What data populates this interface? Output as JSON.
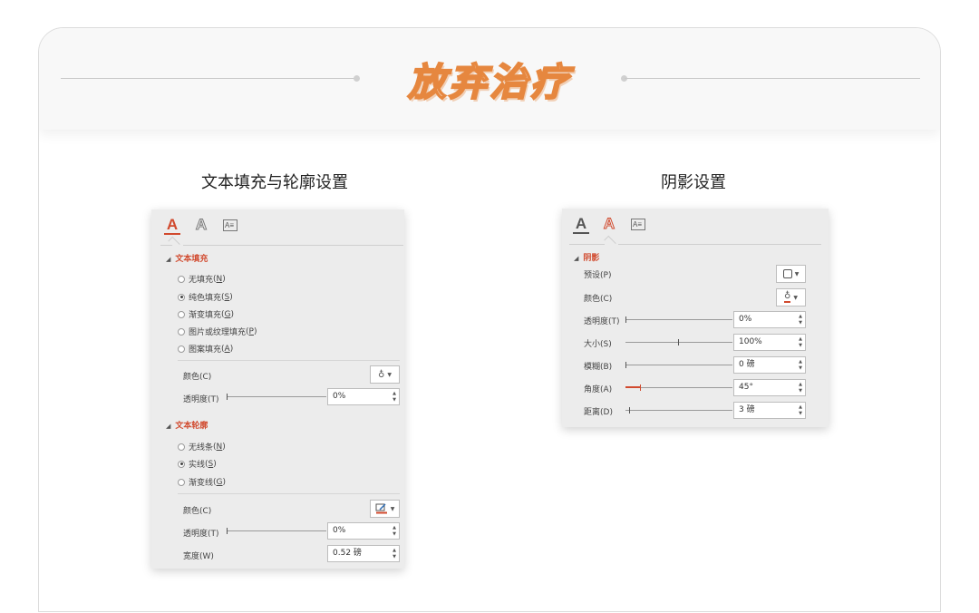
{
  "header": {
    "title": "放弃治疗"
  },
  "left": {
    "section_title": "文本填充与轮廓设置",
    "fill_group": "文本填充",
    "fill_options": [
      {
        "text": "无填充",
        "key": "N",
        "checked": false
      },
      {
        "text": "纯色填充",
        "key": "S",
        "checked": true
      },
      {
        "text": "渐变填充",
        "key": "G",
        "checked": false
      },
      {
        "text": "图片或纹理填充",
        "key": "P",
        "checked": false
      },
      {
        "text": "图案填充",
        "key": "A",
        "checked": false
      }
    ],
    "fill_color_label": "颜色(C)",
    "fill_transparency_label": "透明度(T)",
    "fill_transparency_value": "0%",
    "outline_group": "文本轮廓",
    "outline_options": [
      {
        "text": "无线条",
        "key": "N",
        "checked": false
      },
      {
        "text": "实线",
        "key": "S",
        "checked": true
      },
      {
        "text": "渐变线",
        "key": "G",
        "checked": false
      }
    ],
    "outline_color_label": "颜色(C)",
    "outline_transparency_label": "透明度(T)",
    "outline_transparency_value": "0%",
    "width_label": "宽度(W)",
    "width_value": "0.52 磅",
    "accent_color": "#d14a2e"
  },
  "right": {
    "section_title": "阴影设置",
    "group": "阴影",
    "rows": [
      {
        "label": "预设(P)",
        "kind": "preset"
      },
      {
        "label": "颜色(C)",
        "kind": "color"
      },
      {
        "label": "透明度(T)",
        "kind": "slider",
        "value": "0%"
      },
      {
        "label": "大小(S)",
        "kind": "slider",
        "value": "100%"
      },
      {
        "label": "模糊(B)",
        "kind": "slider",
        "value": "0 磅"
      },
      {
        "label": "角度(A)",
        "kind": "slider",
        "value": "45°"
      },
      {
        "label": "距离(D)",
        "kind": "slider",
        "value": "3 磅"
      }
    ]
  }
}
